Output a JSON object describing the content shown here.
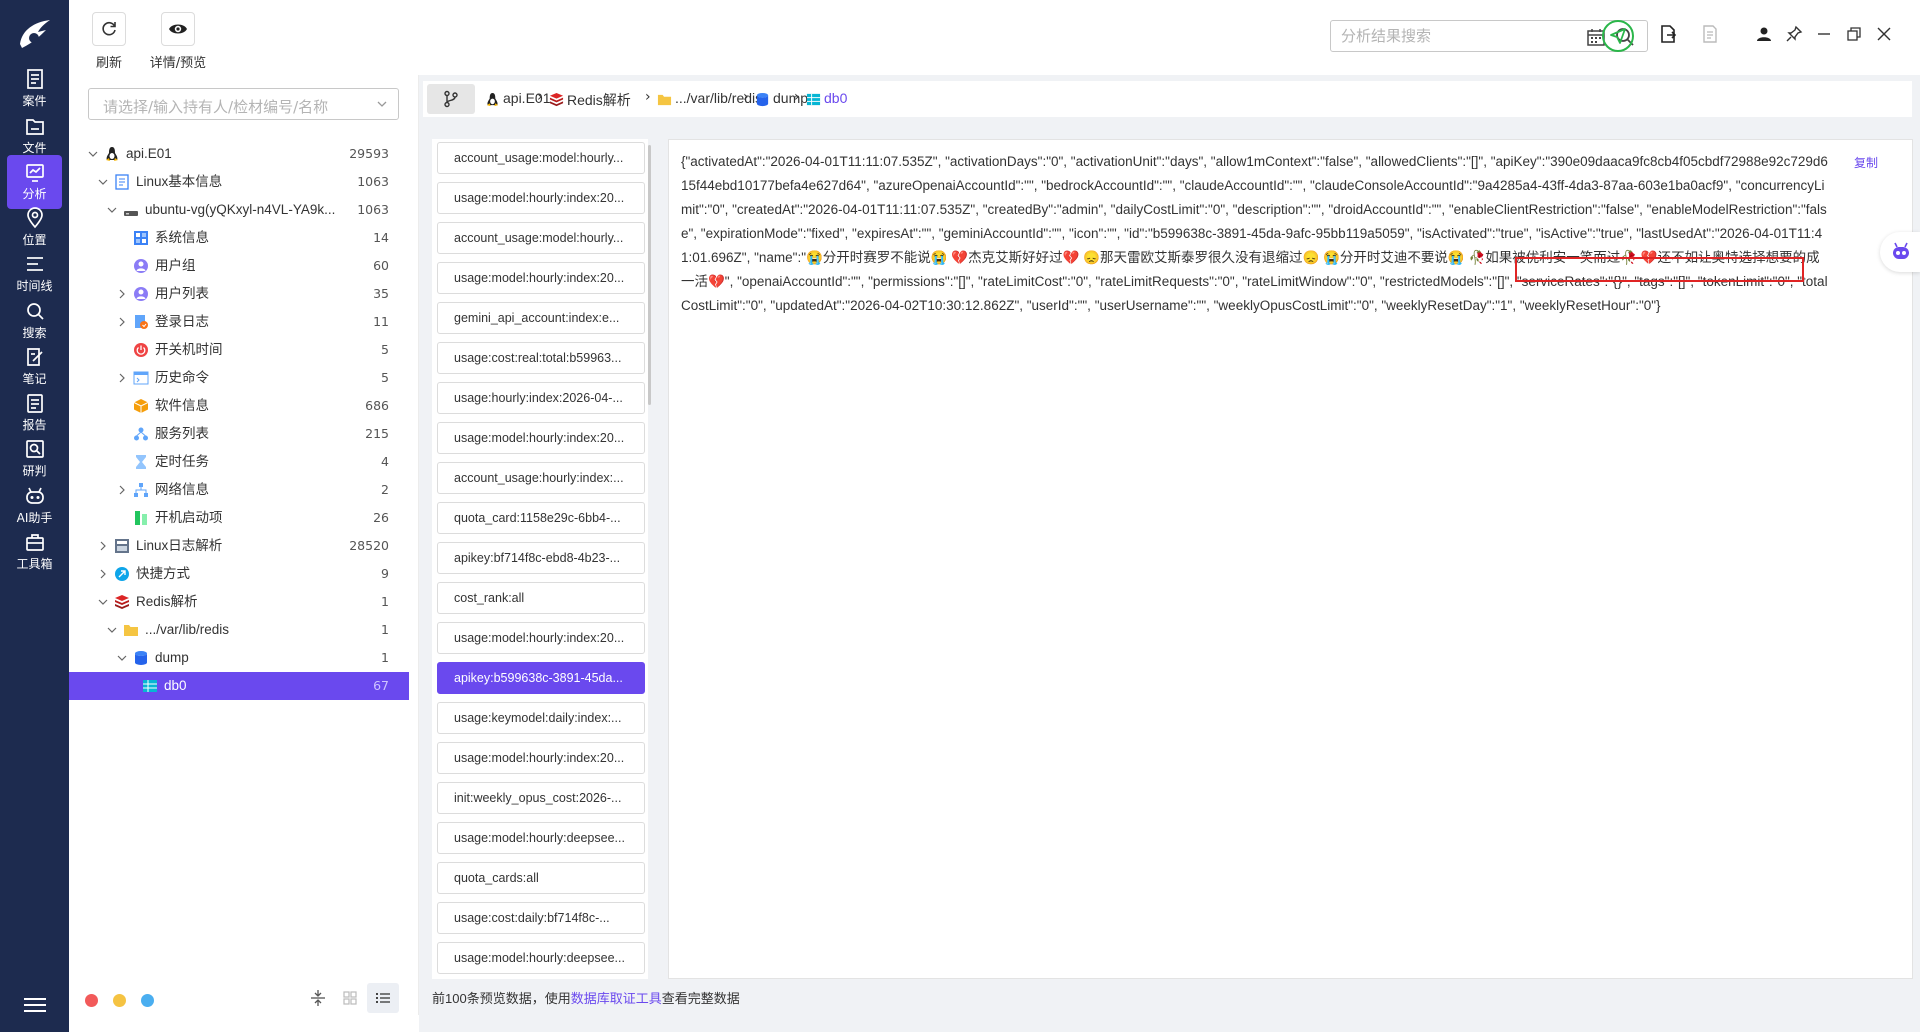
{
  "nav": {
    "items": [
      {
        "label": "案件",
        "icon": "case-icon"
      },
      {
        "label": "文件",
        "icon": "file-icon"
      },
      {
        "label": "分析",
        "icon": "analysis-icon",
        "active": true
      },
      {
        "label": "位置",
        "icon": "location-icon"
      },
      {
        "label": "时间线",
        "icon": "timeline-icon"
      },
      {
        "label": "搜索",
        "icon": "search-icon"
      },
      {
        "label": "笔记",
        "icon": "note-icon"
      },
      {
        "label": "报告",
        "icon": "report-icon"
      },
      {
        "label": "研判",
        "icon": "judge-icon"
      },
      {
        "label": "AI助手",
        "icon": "ai-robot-icon"
      },
      {
        "label": "工具箱",
        "icon": "toolbox-icon"
      }
    ]
  },
  "toolbar": {
    "refresh_label": "刷新",
    "preview_label": "详情/预览",
    "search_placeholder": "分析结果搜索"
  },
  "tree": {
    "select_placeholder": "请选择/输入持有人/检材编号/名称",
    "rows": [
      {
        "label": "api.E01",
        "count": "29593",
        "level": 0,
        "expanded": true,
        "icon": "linux-icon"
      },
      {
        "label": "Linux基本信息",
        "count": "1063",
        "level": 1,
        "expanded": true,
        "icon": "doc-icon"
      },
      {
        "label": "ubuntu-vg(yQKxyl-n4VL-YA9k...",
        "count": "1063",
        "level": 2,
        "expanded": true,
        "icon": "disk-icon"
      },
      {
        "label": "系统信息",
        "count": "14",
        "level": 3,
        "icon": "system-icon"
      },
      {
        "label": "用户组",
        "count": "60",
        "level": 3,
        "icon": "user-group-icon"
      },
      {
        "label": "用户列表",
        "count": "35",
        "level": 3,
        "collapsed": true,
        "icon": "user-list-icon"
      },
      {
        "label": "登录日志",
        "count": "11",
        "level": 3,
        "collapsed": true,
        "icon": "login-log-icon"
      },
      {
        "label": "开关机时间",
        "count": "5",
        "level": 3,
        "icon": "power-icon"
      },
      {
        "label": "历史命令",
        "count": "5",
        "level": 3,
        "collapsed": true,
        "icon": "terminal-icon"
      },
      {
        "label": "软件信息",
        "count": "686",
        "level": 3,
        "icon": "package-icon"
      },
      {
        "label": "服务列表",
        "count": "215",
        "level": 3,
        "icon": "service-icon"
      },
      {
        "label": "定时任务",
        "count": "4",
        "level": 3,
        "icon": "hourglass-icon"
      },
      {
        "label": "网络信息",
        "count": "2",
        "level": 3,
        "collapsed": true,
        "icon": "network-icon"
      },
      {
        "label": "开机启动项",
        "count": "26",
        "level": 3,
        "icon": "startup-icon"
      },
      {
        "label": "Linux日志解析",
        "count": "28520",
        "level": 1,
        "collapsed": true,
        "icon": "log-parse-icon"
      },
      {
        "label": "快捷方式",
        "count": "9",
        "level": 1,
        "collapsed": true,
        "icon": "shortcut-icon"
      },
      {
        "label": "Redis解析",
        "count": "1",
        "level": 1,
        "expanded": true,
        "icon": "redis-icon"
      },
      {
        "label": ".../var/lib/redis",
        "count": "1",
        "level": 2,
        "expanded": true,
        "icon": "folder-icon"
      },
      {
        "label": "dump",
        "count": "1",
        "level": 3,
        "expanded": true,
        "icon": "database-icon"
      },
      {
        "label": "db0",
        "count": "67",
        "level": 4,
        "selected": true,
        "icon": "table-icon"
      }
    ]
  },
  "breadcrumb": {
    "items": [
      {
        "label": "api.E01",
        "icon": "linux-icon"
      },
      {
        "label": "Redis解析",
        "icon": "redis-icon"
      },
      {
        "label": ".../var/lib/redis",
        "icon": "folder-icon"
      },
      {
        "label": "dump",
        "icon": "database-icon"
      },
      {
        "label": "db0",
        "icon": "table-icon",
        "active": true
      }
    ]
  },
  "keys": [
    "account_usage:model:hourly...",
    "usage:model:hourly:index:20...",
    "account_usage:model:hourly...",
    "usage:model:hourly:index:20...",
    "gemini_api_account:index:e...",
    "usage:cost:real:total:b59963...",
    "usage:hourly:index:2026-04-...",
    "usage:model:hourly:index:20...",
    "account_usage:hourly:index:...",
    "quota_card:1158e29c-6bb4-...",
    "apikey:bf714f8c-ebd8-4b23-...",
    "cost_rank:all",
    "usage:model:hourly:index:20...",
    "apikey:b599638c-3891-45da...",
    "usage:keymodel:daily:index:...",
    "usage:model:hourly:index:20...",
    "init:weekly_opus_cost:2026-...",
    "usage:model:hourly:deepsee...",
    "quota_cards:all",
    "usage:cost:daily:bf714f8c-...",
    "usage:model:hourly:deepsee..."
  ],
  "selected_key_index": 13,
  "value": {
    "text": "{\"activatedAt\":\"2026-04-01T11:11:07.535Z\", \"activationDays\":\"0\", \"activationUnit\":\"days\", \"allow1mContext\":\"false\", \"allowedClients\":\"[]\", \"apiKey\":\"390e09daaca9fc8cb4f05cbdf72988e92c729d615f44ebd10177befa4e627d64\", \"azureOpenaiAccountId\":\"\", \"bedrockAccountId\":\"\", \"claudeAccountId\":\"\", \"claudeConsoleAccountId\":\"9a4285a4-43ff-4da3-87aa-603e1ba0acf9\", \"concurrencyLimit\":\"0\", \"createdAt\":\"2026-04-01T11:11:07.535Z\", \"createdBy\":\"admin\", \"dailyCostLimit\":\"0\", \"description\":\"\", \"droidAccountId\":\"\", \"enableClientRestriction\":\"false\", \"enableModelRestriction\":\"false\", \"expirationMode\":\"fixed\", \"expiresAt\":\"\", \"geminiAccountId\":\"\", \"icon\":\"\", \"id\":\"b599638c-3891-45da-9afc-95bb119a5059\", \"isActivated\":\"true\", \"isActive\":\"true\", \"lastUsedAt\":\"2026-04-01T11:41:01.696Z\", \"name\":\"😭分开时赛罗不能说😭 💔杰克艾斯好好过💔 😞那天雷欧艾斯泰罗很久没有退缩过😞 😭分开时艾迪不要说😭 🥀如果被优利安一笑而过🥀 💔还不如让奥特选择想要的成一活💔\", \"openaiAccountId\":\"\", \"permissions\":\"[]\", \"rateLimitCost\":\"0\", \"rateLimitRequests\":\"0\", \"rateLimitWindow\":\"0\", \"restrictedModels\":\"[]\", \"serviceRates\":\"{}\", \"tags\":\"[]\", \"tokenLimit\":\"0\", \"totalCostLimit\":\"0\", \"updatedAt\":\"2026-04-02T10:30:12.862Z\", \"userId\":\"\", \"userUsername\":\"\", \"weeklyOpusCostLimit\":\"0\", \"weeklyResetDay\":\"1\", \"weeklyResetHour\":\"0\"}",
    "copy_label": "复制"
  },
  "footer": {
    "prefix": "前100条预览数据，使用",
    "link": "数据库取证工具",
    "suffix": "查看完整数据"
  },
  "colors": {
    "nav_bg": "#1d2b4f",
    "accent": "#6a49ee",
    "highlight": "#e02424",
    "dot_red": "#f25a5a",
    "dot_yellow": "#f5c342",
    "dot_blue": "#4aaef0"
  }
}
